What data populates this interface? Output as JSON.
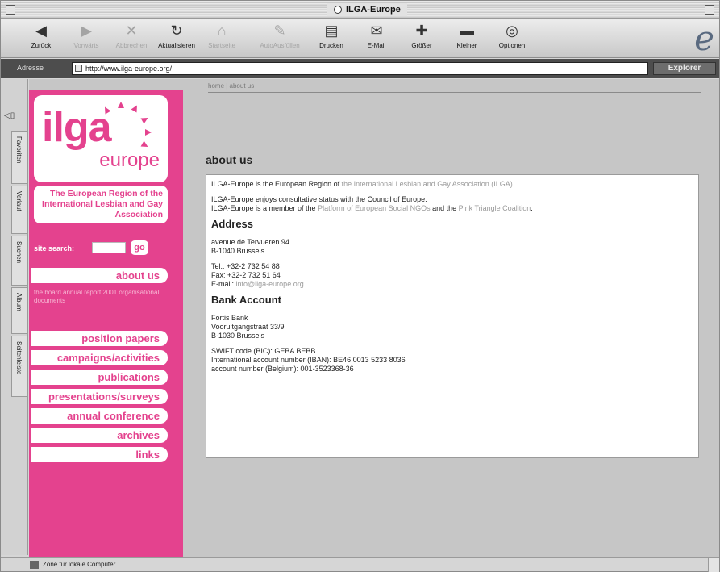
{
  "window": {
    "title": "ILGA-Europe"
  },
  "toolbar": {
    "buttons": [
      {
        "label": "Zurück",
        "icon": "back-arrow-icon"
      },
      {
        "label": "Vorwärts",
        "icon": "forward-arrow-icon"
      },
      {
        "label": "Abbrechen",
        "icon": "stop-icon"
      },
      {
        "label": "Aktualisieren",
        "icon": "refresh-icon"
      },
      {
        "label": "Startseite",
        "icon": "home-icon"
      },
      {
        "label": "AutoAusfüllen",
        "icon": "autofill-icon"
      },
      {
        "label": "Drucken",
        "icon": "print-icon"
      },
      {
        "label": "E-Mail",
        "icon": "mail-icon"
      },
      {
        "label": "Größer",
        "icon": "plus-icon"
      },
      {
        "label": "Kleiner",
        "icon": "minus-icon"
      },
      {
        "label": "Optionen",
        "icon": "options-icon"
      }
    ]
  },
  "address": {
    "label": "Adresse",
    "url": "http://www.ilga-europe.org/",
    "go_label": "Explorer"
  },
  "explorer_tabs": [
    "Favoriten",
    "Verlauf",
    "Suchen",
    "Album",
    "Seitenleiste"
  ],
  "sidebar": {
    "logo_main": "ilga",
    "logo_sub": "europe",
    "tagline": "The European Region of the International Lesbian and Gay Association",
    "search_label": "site search:",
    "go_label": "go",
    "active_item": "about us",
    "submenu": "the board  annual report 2001  organisational documents",
    "nav": [
      "position papers",
      "campaigns/activities",
      "publications",
      "presentations/surveys",
      "annual conference",
      "archives",
      "links"
    ]
  },
  "content": {
    "breadcrumb": "home | about us",
    "heading": "about us",
    "intro_prefix": "ILGA-Europe is the European Region of ",
    "intro_link": "the International Lesbian and Gay Association (ILGA).",
    "status_line1": "ILGA-Europe enjoys consultative status with the Council of Europe.",
    "status_line2_prefix": "ILGA-Europe is a member of the ",
    "status_link1": "Platform of European Social NGOs",
    "status_mid": " and the ",
    "status_link2": "Pink Triangle Coalition",
    "status_end": ".",
    "address_heading": "Address",
    "address_line1": "avenue de Tervueren 94",
    "address_line2": "B-1040 Brussels",
    "tel": "Tel.: +32-2 732 54 88",
    "fax": "Fax: +32-2 732 51 64",
    "email_label": "E-mail: ",
    "email": "info@ilga-europe.org",
    "bank_heading": "Bank Account",
    "bank_line1": "Fortis Bank",
    "bank_line2": "Vooruitgangstraat 33/9",
    "bank_line3": "B-1030 Brussels",
    "swift": "SWIFT code (BIC): GEBA BEBB",
    "iban": "International account number (IBAN): BE46 0013 5233 8036",
    "account": "account number (Belgium): 001-3523368-36"
  },
  "status": {
    "text": "Zone für lokale Computer"
  },
  "colors": {
    "brand_pink": "#e4428e",
    "link_gray": "#9a9a9a"
  }
}
